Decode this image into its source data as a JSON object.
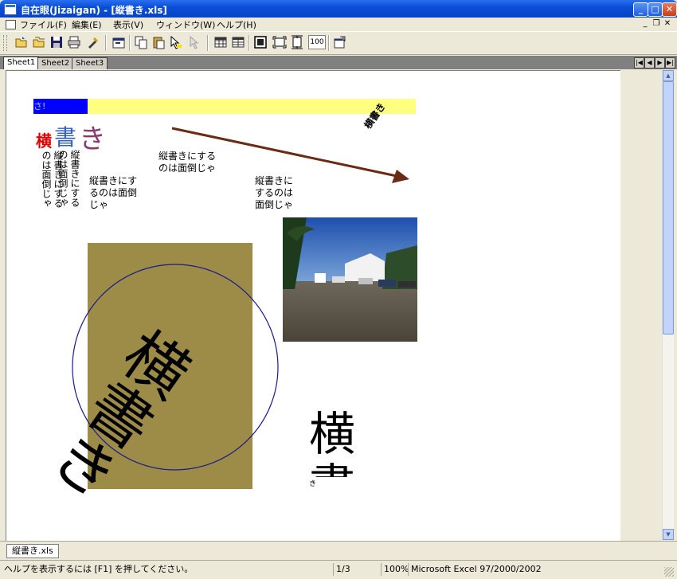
{
  "window": {
    "title": "自在眼(Jizaigan) - [縦書き.xls]",
    "min_label": "_",
    "max_label": "□",
    "close_label": "✕"
  },
  "menu": {
    "items": [
      "ファイル(F)",
      "編集(E)",
      "表示(V)",
      "ウィンドウ(W)",
      "ヘルプ(H)"
    ],
    "mdi_controls": [
      "_",
      "❐",
      "✕"
    ]
  },
  "toolbar": {
    "zoom_button_label": "100"
  },
  "sheet_tabs": [
    "Sheet1",
    "Sheet2",
    "Sheet3"
  ],
  "sheet": {
    "banner_text": "さ!",
    "heading_chars": [
      "横",
      "書",
      "き"
    ],
    "heading_colors": [
      "#e00000",
      "#3060c0",
      "#8b3a70"
    ],
    "rotated_small_text": "横書き",
    "text_vertical_1": "縦書きにするのは面倒じゃ",
    "text_vertical_2": "縦書きにするのは面倒じゃ",
    "text_horizontal_1": "縦書きにする\nのは面倒じゃ",
    "text_horizontal_2": "縦書きにす\nるのは面倒\nじゃ",
    "text_horizontal_3": "縦書きに\nするのは\n面倒じゃ",
    "rotated_big_text": "横書き",
    "big_char": "横",
    "big_char_partial": "書",
    "tiny_char": "き"
  },
  "colors": {
    "banner_blue": "#0000ff",
    "banner_yellow": "#ffff80",
    "arrow": "#6b2a14",
    "box_fill": "#9c8c48",
    "circle": "#1a1a8a"
  },
  "file_tabs": [
    "縦書き.xls"
  ],
  "status": {
    "help": "ヘルプを表示するには [F1] を押してください。",
    "page": "1/3",
    "zoom": "100%",
    "format": "Microsoft Excel 97/2000/2002"
  }
}
